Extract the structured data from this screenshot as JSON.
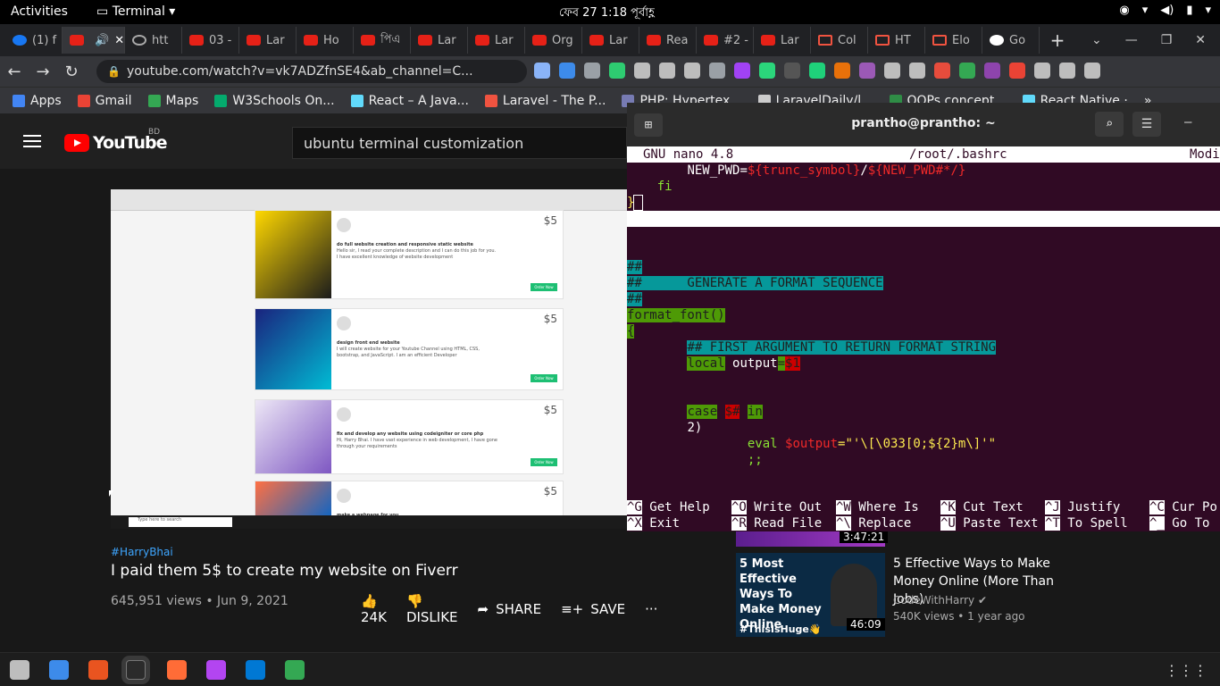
{
  "topbar": {
    "activities": "Activities",
    "app_name": "Terminal",
    "clock": "ফেব 27   1:18 পূর্বাহ্ণ"
  },
  "tabs": [
    {
      "label": "(1) f",
      "icon": "facebook"
    },
    {
      "label": "",
      "icon": "youtube",
      "active": true
    },
    {
      "label": "htt",
      "icon": "globe"
    },
    {
      "label": "03 -",
      "icon": "youtube"
    },
    {
      "label": "Lar",
      "icon": "youtube"
    },
    {
      "label": "Ho",
      "icon": "youtube"
    },
    {
      "label": "পিএ",
      "icon": "youtube"
    },
    {
      "label": "Lar",
      "icon": "youtube"
    },
    {
      "label": "Lar",
      "icon": "youtube"
    },
    {
      "label": "Org",
      "icon": "youtube"
    },
    {
      "label": "Lar",
      "icon": "youtube"
    },
    {
      "label": "Rea",
      "icon": "youtube"
    },
    {
      "label": "#2 -",
      "icon": "youtube"
    },
    {
      "label": "Lar",
      "icon": "youtube"
    },
    {
      "label": "Col",
      "icon": "laravel"
    },
    {
      "label": "HT",
      "icon": "laravel"
    },
    {
      "label": "Elo",
      "icon": "laravel"
    },
    {
      "label": "Go",
      "icon": "google"
    }
  ],
  "browser": {
    "url": "youtube.com/watch?v=vk7ADZfnSE4&ab_channel=C..."
  },
  "bookmarks": [
    {
      "label": "Apps",
      "color": "#4285f4"
    },
    {
      "label": "Gmail",
      "color": "#ea4335"
    },
    {
      "label": "Maps",
      "color": "#34a853"
    },
    {
      "label": "W3Schools On...",
      "color": "#04aa6d"
    },
    {
      "label": "React – A Java...",
      "color": "#61dafb"
    },
    {
      "label": "Laravel - The P...",
      "color": "#f05340"
    },
    {
      "label": "PHP: Hypertex...",
      "color": "#777bb3"
    },
    {
      "label": "LaravelDaily/l...",
      "color": "#cccccc"
    },
    {
      "label": "OOPs concept...",
      "color": "#2f8d46"
    },
    {
      "label": "React Native ·",
      "color": "#61dafb"
    }
  ],
  "youtube": {
    "logo_text": "YouTube",
    "country": "BD",
    "search_query": "ubuntu terminal customization",
    "video": {
      "hashtag": "#HarryBhai",
      "title": "I paid them 5$ to create my website on Fiverr",
      "meta": "645,951 views • Jun 9, 2021",
      "likes": "24K",
      "dislike": "DISLIKE",
      "share": "SHARE",
      "save": "SAVE"
    },
    "frame_gigs": [
      {
        "price": "$5",
        "title": "do full website creation and responsive static website",
        "text": "Hello sir, I read your complete description and I can do this job for you. I have excellent knowledge of website development",
        "button": "Order Now"
      },
      {
        "price": "$5",
        "title": "design front end website",
        "text": "I will create website for your Youtube Channel using HTML, CSS, bootstrap, and JavaScript. I am an efficient Developer",
        "button": "Order Now"
      },
      {
        "price": "$5",
        "title": "fix and develop any website using codeigniter or core php",
        "text": "Hi, Harry Bhai. I have vast experience in web development, I have gone through your requirements",
        "button": "Order Now"
      },
      {
        "price": "$5",
        "title": "make a webpage for you",
        "text": "",
        "button": ""
      }
    ],
    "frame_taskbar_search": "Type here to search",
    "sidebar": {
      "first_duration": "3:47:21",
      "thumb_text": "5 Most Effective Ways To Make Money Online",
      "thumb_hashtag": "#ThisIsHuge👋",
      "title": "5 Effective Ways to Make Money Online (More Than Jobs)",
      "channel": "CodeWithHarry",
      "views": "540K views • 1 year ago",
      "duration": "46:09"
    }
  },
  "terminal": {
    "title": "prantho@prantho: ~",
    "nano_version": "GNU nano 4.8",
    "file": "/root/.bashrc",
    "status": "Modi",
    "lines": [
      {
        "indent": "        ",
        "parts": [
          [
            "NEW_PWD=",
            ""
          ],
          [
            "${trunc_symbol}",
            "red"
          ],
          [
            "/",
            ""
          ],
          [
            "${NEW_PWD#*/}",
            "red"
          ]
        ]
      },
      {
        "indent": "    ",
        "parts": [
          [
            "fi",
            "dim"
          ]
        ]
      },
      {
        "indent": "",
        "parts": [
          [
            "}",
            "yel"
          ]
        ]
      },
      {
        "indent": "",
        "parts": [
          [
            "",
            ""
          ]
        ],
        "white": true
      },
      {
        "indent": "",
        "parts": [
          [
            "",
            ""
          ]
        ]
      },
      {
        "indent": "",
        "parts": [
          [
            "",
            ""
          ]
        ]
      },
      {
        "indent": "",
        "parts": [
          [
            "##",
            "hl"
          ]
        ]
      },
      {
        "indent": "",
        "parts": [
          [
            "##      GENERATE A FORMAT SEQUENCE",
            "hl"
          ]
        ]
      },
      {
        "indent": "",
        "parts": [
          [
            "##",
            "hl"
          ]
        ]
      },
      {
        "indent": "",
        "parts": [
          [
            "format_font()",
            "grn"
          ]
        ]
      },
      {
        "indent": "",
        "parts": [
          [
            "{",
            "grn"
          ]
        ]
      },
      {
        "indent": "        ",
        "parts": [
          [
            "## FIRST ARGUMENT TO RETURN FORMAT STRING",
            "hl"
          ]
        ]
      },
      {
        "indent": "        ",
        "parts": [
          [
            "local",
            "grn"
          ],
          [
            " output",
            ""
          ],
          [
            "=",
            "grn"
          ],
          [
            "$1",
            "redbg"
          ]
        ]
      },
      {
        "indent": "",
        "parts": [
          [
            "",
            ""
          ]
        ]
      },
      {
        "indent": "",
        "parts": [
          [
            "",
            ""
          ]
        ]
      },
      {
        "indent": "        ",
        "parts": [
          [
            "case",
            "grn"
          ],
          [
            " ",
            ""
          ],
          [
            "$#",
            "redbg"
          ],
          [
            " ",
            ""
          ],
          [
            "in",
            "grn"
          ]
        ]
      },
      {
        "indent": "        ",
        "parts": [
          [
            "2)",
            ""
          ]
        ]
      },
      {
        "indent": "                ",
        "parts": [
          [
            "eval ",
            "dim"
          ],
          [
            "$output",
            "red"
          ],
          [
            "=\"'\\[\\033[0;${2}m\\]'\"",
            "yel"
          ]
        ]
      },
      {
        "indent": "                ",
        "parts": [
          [
            ";;",
            "dim"
          ]
        ]
      }
    ],
    "help_row1": [
      [
        "^G",
        "Get Help"
      ],
      [
        "^O",
        "Write Out"
      ],
      [
        "^W",
        "Where Is"
      ],
      [
        "^K",
        "Cut Text"
      ],
      [
        "^J",
        "Justify"
      ],
      [
        "^C",
        "Cur Po"
      ]
    ],
    "help_row2": [
      [
        "^X",
        "Exit"
      ],
      [
        "^R",
        "Read File"
      ],
      [
        "^\\",
        "Replace"
      ],
      [
        "^U",
        "Paste Text"
      ],
      [
        "^T",
        "To Spell"
      ],
      [
        "^_",
        "Go To"
      ]
    ]
  },
  "dock": [
    {
      "name": "files",
      "color": "#bdbdbd"
    },
    {
      "name": "text-editor",
      "color": "#3d8bea"
    },
    {
      "name": "software",
      "color": "#e95420"
    },
    {
      "name": "terminal",
      "color": "#2b2b2b"
    },
    {
      "name": "postman",
      "color": "#ff6c37"
    },
    {
      "name": "phpstorm",
      "color": "#b345f1"
    },
    {
      "name": "vscode",
      "color": "#0078d4"
    },
    {
      "name": "chrome",
      "color": "#34a853"
    }
  ]
}
